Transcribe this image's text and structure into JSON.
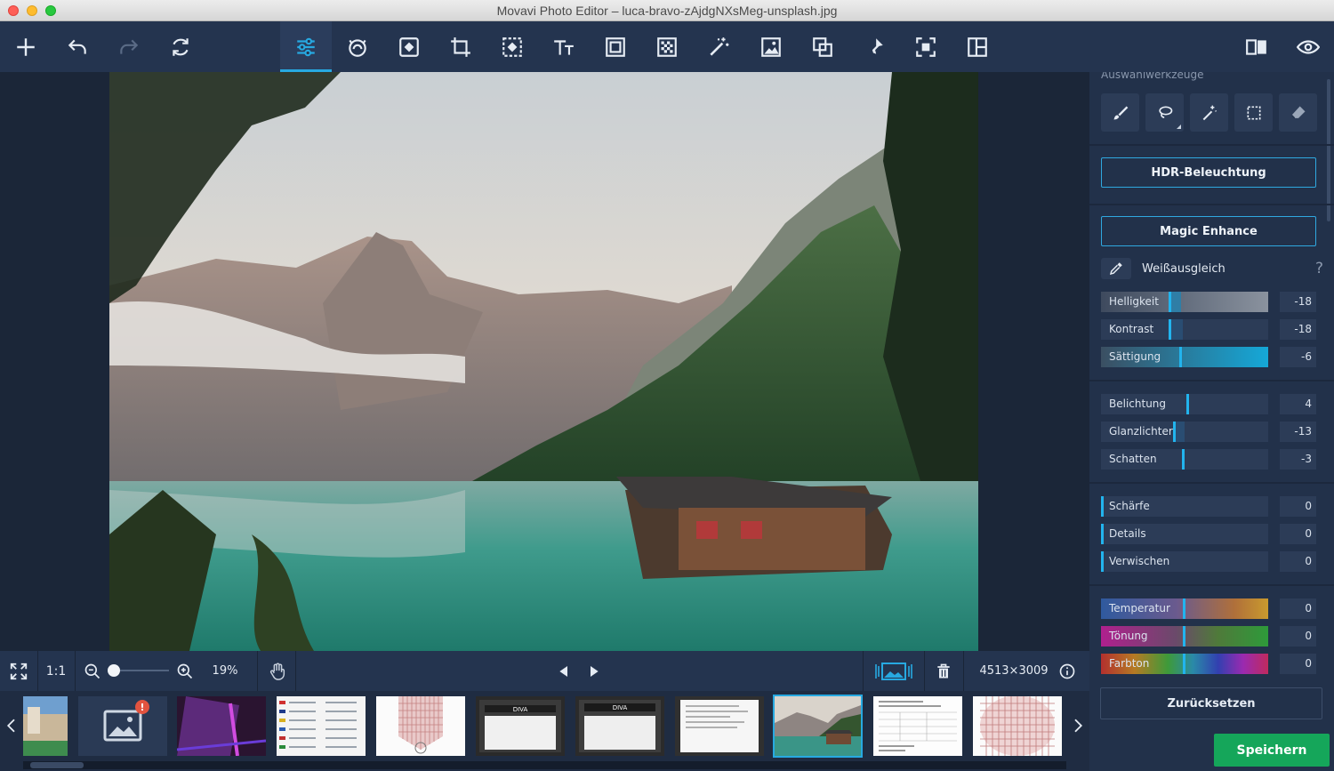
{
  "window": {
    "title": "Movavi Photo Editor – luca-bravo-zAjdgNXsMeg-unsplash.jpg"
  },
  "toolbar": {
    "items": [
      {
        "icon": "plus-icon"
      },
      {
        "icon": "undo-icon"
      },
      {
        "icon": "redo-icon"
      },
      {
        "icon": "reset-icon"
      },
      {
        "icon": "adjust-sliders-icon",
        "active": true
      },
      {
        "icon": "retouch-icon"
      },
      {
        "icon": "object-removal-icon"
      },
      {
        "icon": "crop-icon"
      },
      {
        "icon": "background-replace-icon"
      },
      {
        "icon": "text-icon"
      },
      {
        "icon": "frame-icon"
      },
      {
        "icon": "noise-icon"
      },
      {
        "icon": "magic-wand-icon"
      },
      {
        "icon": "insert-image-icon"
      },
      {
        "icon": "resize-icon"
      },
      {
        "icon": "pin-icon"
      },
      {
        "icon": "selection-transform-icon"
      },
      {
        "icon": "layout-icon"
      }
    ],
    "right_items": [
      {
        "icon": "compare-icon"
      },
      {
        "icon": "eye-icon"
      }
    ]
  },
  "panel": {
    "section_heading": "Auswahlwerkzeuge",
    "selection_tools": [
      "brush-icon",
      "lasso-icon",
      "magic-wand-icon",
      "rect-select-icon",
      "eraser-icon"
    ],
    "hdr_button": "HDR-Beleuchtung",
    "magic_button": "Magic Enhance",
    "white_balance": {
      "label": "Weißausgleich",
      "help": "?"
    },
    "sliders_group1": [
      {
        "label": "Helligkeit",
        "value": "-18"
      },
      {
        "label": "Kontrast",
        "value": "-18"
      },
      {
        "label": "Sättigung",
        "value": "-6"
      }
    ],
    "sliders_group2": [
      {
        "label": "Belichtung",
        "value": "4"
      },
      {
        "label": "Glanzlichter",
        "value": "-13"
      },
      {
        "label": "Schatten",
        "value": "-3"
      }
    ],
    "sliders_group3": [
      {
        "label": "Schärfe",
        "value": "0"
      },
      {
        "label": "Details",
        "value": "0"
      },
      {
        "label": "Verwischen",
        "value": "0"
      }
    ],
    "sliders_group4": [
      {
        "label": "Temperatur",
        "value": "0"
      },
      {
        "label": "Tönung",
        "value": "0"
      },
      {
        "label": "Farbton",
        "value": "0"
      }
    ],
    "reset_button": "Zurücksetzen",
    "save_button": "Speichern"
  },
  "bottombar": {
    "one_to_one": "1:1",
    "zoom_percent": "19%",
    "dimensions": "4513×3009"
  },
  "filmstrip": {
    "count": 11,
    "selected_index": 8,
    "badge": "!"
  },
  "colors": {
    "accent": "#27a9e1",
    "save_green": "#15a65a",
    "panel_bg": "#22314a",
    "toolbar_bg": "#24344f"
  }
}
